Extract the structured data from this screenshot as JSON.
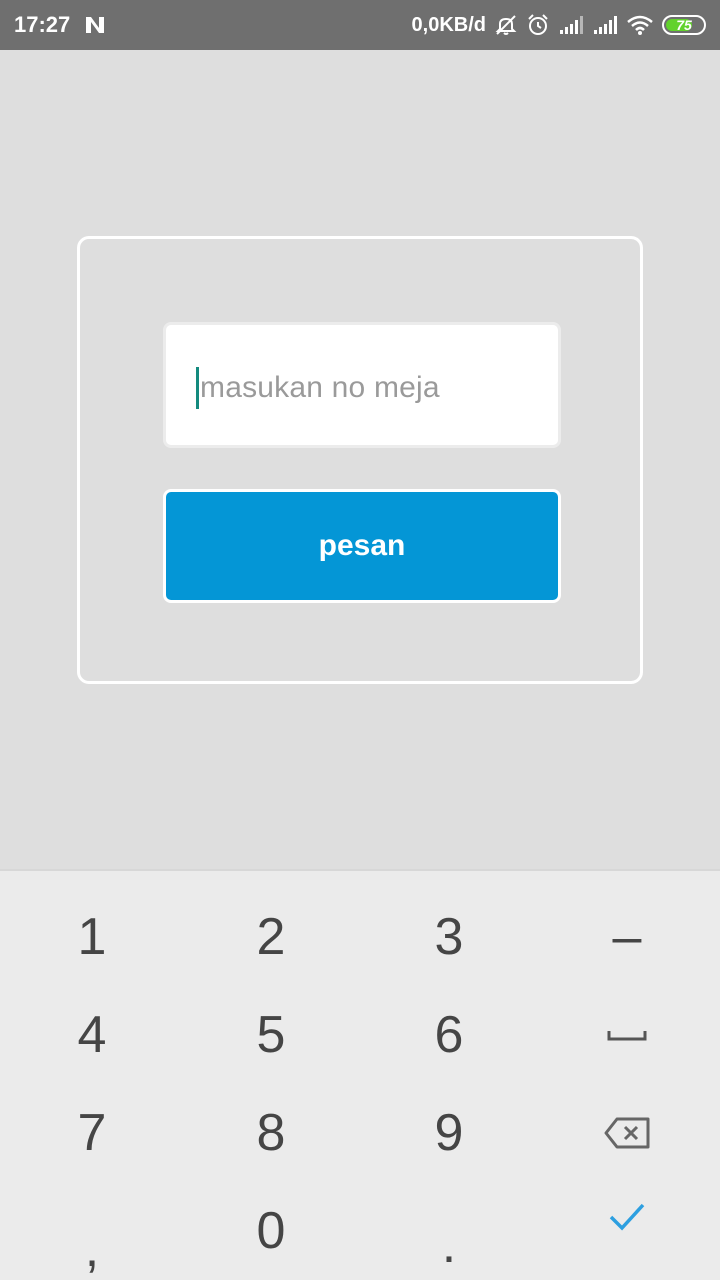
{
  "status_bar": {
    "time": "17:27",
    "net_speed": "0,0KB/d",
    "battery_level": "75",
    "battery_percent": 75,
    "icons": [
      "notification-n-icon",
      "mute-icon",
      "alarm-icon",
      "signal-icon",
      "signal-icon",
      "wifi-icon",
      "battery-icon"
    ],
    "battery_color": "#62d22d"
  },
  "form": {
    "table_input_placeholder": "masukan no meja",
    "order_button_label": "pesan",
    "button_color": "#0496d6"
  },
  "keyboard": {
    "keys": [
      {
        "label": "1"
      },
      {
        "label": "2"
      },
      {
        "label": "3"
      },
      {
        "label": "–"
      },
      {
        "label": "4"
      },
      {
        "label": "5"
      },
      {
        "label": "6"
      },
      {
        "icon": "space-icon"
      },
      {
        "label": "7"
      },
      {
        "label": "8"
      },
      {
        "label": "9"
      },
      {
        "icon": "backspace-icon"
      },
      {
        "label": ","
      },
      {
        "label": "0"
      },
      {
        "label": "."
      },
      {
        "icon": "checkmark-icon"
      }
    ],
    "check_color": "#2d9fe0"
  }
}
